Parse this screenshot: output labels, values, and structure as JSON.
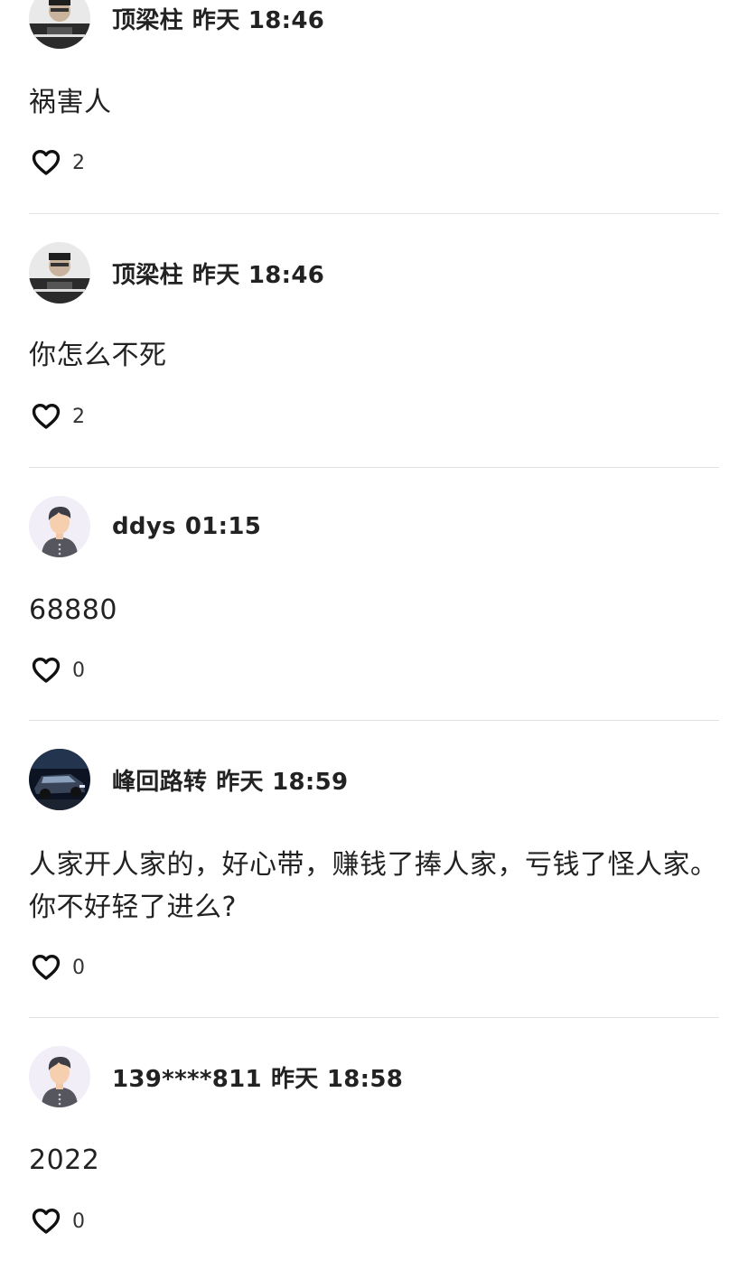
{
  "comments": [
    {
      "username": "顶梁柱",
      "time": "昨天 18:46",
      "avatar_icon": "photo-avatar-person",
      "content": "祸害人",
      "likes": "2"
    },
    {
      "username": "顶梁柱",
      "time": "昨天 18:46",
      "avatar_icon": "photo-avatar-person",
      "content": "你怎么不死",
      "likes": "2"
    },
    {
      "username": "ddys",
      "time": "01:15",
      "avatar_icon": "default-avatar-icon",
      "content": "68880",
      "likes": "0"
    },
    {
      "username": "峰回路转",
      "time": "昨天 18:59",
      "avatar_icon": "photo-avatar-car",
      "content": "人家开人家的，好心带，赚钱了捧人家，亏钱了怪人家。你不好轻了进么?",
      "likes": "0"
    },
    {
      "username": "139****811",
      "time": "昨天 18:58",
      "avatar_icon": "default-avatar-icon",
      "content": "2022",
      "likes": "0"
    }
  ],
  "colors": {
    "text": "#222222",
    "divider": "#e2e2e2",
    "default_avatar_bg": "#f1eef8"
  }
}
